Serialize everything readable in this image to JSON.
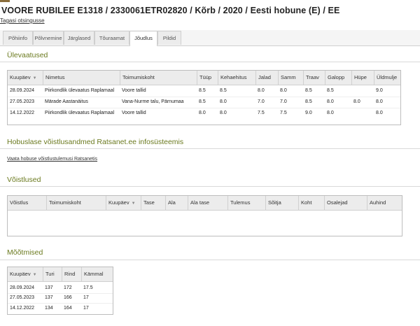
{
  "header": {
    "title": "VOORE RUBILEE E1318 / 2330061ETR02820 / Kõrb / 2020 / Eesti hobune (E) / EE",
    "back_link": "Tagasi otsingusse"
  },
  "tabs": [
    {
      "label": "Põhiinfo",
      "active": false
    },
    {
      "label": "Põlvnemine",
      "active": false
    },
    {
      "label": "Järglased",
      "active": false
    },
    {
      "label": "Tõuraamat",
      "active": false
    },
    {
      "label": "Jõudlus",
      "active": true
    },
    {
      "label": "Pildid",
      "active": false
    }
  ],
  "overview": {
    "title": "Ülevaatused",
    "columns": [
      "Kuupäev",
      "Nimetus",
      "Toimumiskoht",
      "Tüüp",
      "Kehaehitus",
      "Jalad",
      "Samm",
      "Traav",
      "Galopp",
      "Hüpe",
      "Üldmulje"
    ],
    "rows": [
      [
        "28.09.2024",
        "Piirkondlik ülevaatus Raplamaal",
        "Voore tallid",
        "8.5",
        "8.5",
        "8.0",
        "8.0",
        "8.5",
        "8.5",
        "",
        "9.0"
      ],
      [
        "27.05.2023",
        "Märade Aastanäitus",
        "Vana-Nurme talu, Pärnumaa",
        "8.5",
        "8.0",
        "7.0",
        "7.0",
        "8.5",
        "8.0",
        "8.0",
        "8.0"
      ],
      [
        "14.12.2022",
        "Piirkondlik ülevaatus Raplamaal",
        "Voore tallid",
        "8.0",
        "8.0",
        "7.5",
        "7.5",
        "9.0",
        "8.0",
        "",
        "8.0"
      ]
    ]
  },
  "ratsanet": {
    "title": "Hobuslase võistlusandmed Ratsanet.ee infosüsteemis",
    "link": "Vaata hobuse võistlustulemusi Ratsanetis"
  },
  "competitions": {
    "title": "Võistlused",
    "columns": [
      "Võistlus",
      "Toimumiskoht",
      "Kuupäev",
      "Tase",
      "Ala",
      "Ala tase",
      "Tulemus",
      "Sõitja",
      "Koht",
      "Osalejad",
      "Auhind"
    ],
    "rows": []
  },
  "measurements": {
    "title": "Mõõtmised",
    "columns": [
      "Kuupäev",
      "Turi",
      "Rind",
      "Kämmal"
    ],
    "rows": [
      [
        "28.09.2024",
        "137",
        "172",
        "17.5"
      ],
      [
        "27.05.2023",
        "137",
        "166",
        "17"
      ],
      [
        "14.12.2022",
        "134",
        "164",
        "17"
      ]
    ]
  },
  "colors": {
    "section_title": "#6b7a1f",
    "tab_active_bg": "#ffffff",
    "tab_bg": "#ececec",
    "grid_header_bg": "#ececec"
  }
}
